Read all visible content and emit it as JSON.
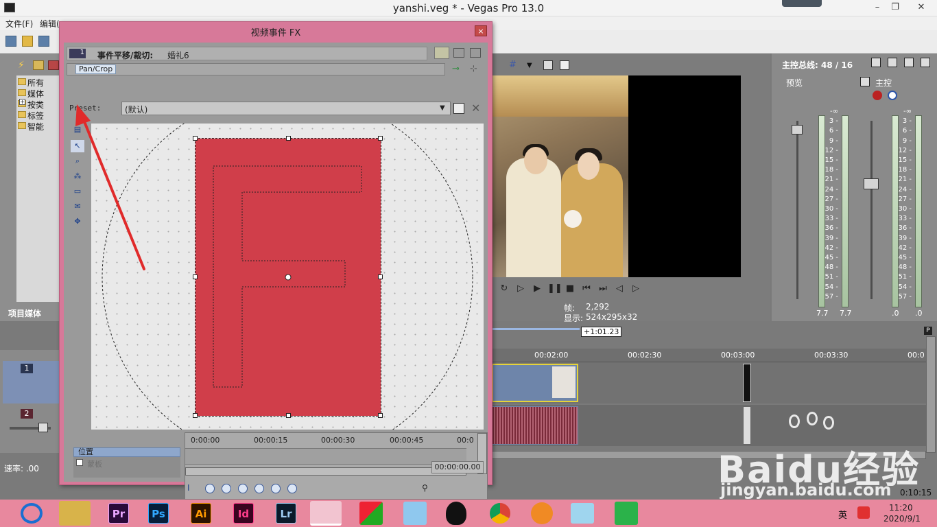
{
  "window": {
    "title": "yanshi.veg * - Vegas Pro 13.0",
    "minimize": "–",
    "maximize": "❐",
    "close": "✕"
  },
  "menu": [
    "文件(F)",
    "编辑("
  ],
  "media_panel": {
    "tree": [
      "所有",
      "媒体",
      "按类",
      "标签",
      "智能"
    ],
    "tab_label": "项目媒体"
  },
  "preview": {
    "frame_label": "帧:",
    "frame_value": "2,292",
    "display_label": "显示:",
    "display_value": "524x295x32"
  },
  "mixer": {
    "title": "主控总线: 48 / 16",
    "preview_label": "预览",
    "master_label": "主控",
    "scale": [
      "-∞",
      "3 -",
      "6 -",
      "9 -",
      "12 -",
      "15 -",
      "18 -",
      "21 -",
      "24 -",
      "27 -",
      "30 -",
      "33 -",
      "36 -",
      "39 -",
      "42 -",
      "45 -",
      "48 -",
      "51 -",
      "54 -",
      "57 -"
    ],
    "preview_vals": [
      "7.7",
      "7.7"
    ],
    "master_vals": [
      ".0",
      ".0"
    ]
  },
  "timeline": {
    "marker": "+1:01.23",
    "ticks": [
      "00:02:00",
      "00:02:30",
      "00:03:00",
      "00:03:30",
      "00:0"
    ],
    "status_rate": "速率: .00",
    "track1": "1",
    "track2": "2",
    "end_time": "0:10:15"
  },
  "fx_dialog": {
    "title": "视频事件 FX",
    "close": "×",
    "chain_num": "1",
    "chain_label": "事件平移/裁切:",
    "chain_event": "婚礼6",
    "plugin_chip": "Pan/Crop",
    "preset_label": "Preset:",
    "preset_value": "(默认)",
    "track_position": "位置",
    "track_mask": "蒙板",
    "kf_ticks": [
      "0:00:00",
      "00:00:15",
      "00:00:30",
      "00:00:45",
      "00:0"
    ],
    "kf_time": "00:00:00.00"
  },
  "taskbar": {
    "apps": [
      {
        "name": "Pr",
        "color": "#2a0a3a",
        "fg": "#e9a6ff"
      },
      {
        "name": "Ps",
        "color": "#061e3a",
        "fg": "#31a8ff"
      },
      {
        "name": "Ai",
        "color": "#2d1300",
        "fg": "#ff9a00"
      },
      {
        "name": "Id",
        "color": "#3a0420",
        "fg": "#ff3d8b"
      },
      {
        "name": "Lr",
        "color": "#0b1a2a",
        "fg": "#9ecbf0"
      }
    ],
    "time": "11:20",
    "date": "2020/9/1",
    "ime": "英"
  },
  "watermark": {
    "text": "Baidu经验",
    "url": "jingyan.baidu.com"
  },
  "colors": {
    "accent": "#d77999",
    "frame_fill": "#d03e4a",
    "annotation_arrow": "#e02a2a"
  }
}
